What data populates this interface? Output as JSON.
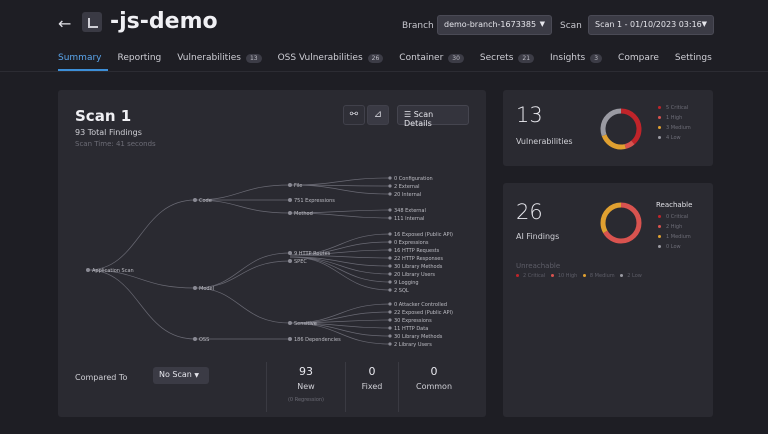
{
  "header": {
    "back": "←",
    "title": "-js-demo",
    "branch_label": "Branch",
    "branch_value": "demo-branch-1673385",
    "scan_label": "Scan",
    "scan_value": "Scan 1 - 01/10/2023 03:16"
  },
  "tabs": [
    {
      "label": "Summary",
      "badge": null,
      "active": true
    },
    {
      "label": "Reporting",
      "badge": null
    },
    {
      "label": "Vulnerabilities",
      "badge": "13"
    },
    {
      "label": "OSS Vulnerabilities",
      "badge": "26"
    },
    {
      "label": "Container",
      "badge": "30"
    },
    {
      "label": "Secrets",
      "badge": "21"
    },
    {
      "label": "Insights",
      "badge": "3"
    },
    {
      "label": "Compare",
      "badge": null
    },
    {
      "label": "Settings",
      "badge": null
    }
  ],
  "summary": {
    "scan_title": "Scan 1",
    "total_findings": "93 Total Findings",
    "scan_time": "Scan Time: 41 seconds",
    "details_button": "Scan Details",
    "tree": {
      "root": "Application Scan",
      "level1": [
        "Code",
        "Model",
        "OSS"
      ],
      "level2": [
        "File",
        "751 Expressions",
        "Method",
        "9 HTTP Routes",
        "SPEC",
        "Sensitive",
        "186 Dependencies"
      ],
      "leaves": [
        "0 Configuration",
        "2 External",
        "20 Internal",
        "348 External",
        "111 Internal",
        "16 Exposed (Public API)",
        "0 Expressions",
        "16 HTTP Requests",
        "22 HTTP Responses",
        "30 Library Methods",
        "20 Library Users",
        "9 Logging",
        "2 SQL",
        "0 Attacker Controlled",
        "22 Exposed (Public API)",
        "30 Expressions",
        "11 HTTP Data",
        "30 Library Methods",
        "2 Library Users"
      ]
    },
    "compared_label": "Compared To",
    "compared_value": "No Scan",
    "stats": [
      {
        "value": "93",
        "label": "New",
        "sub": "(0 Regression)"
      },
      {
        "value": "0",
        "label": "Fixed",
        "sub": ""
      },
      {
        "value": "0",
        "label": "Common",
        "sub": ""
      }
    ]
  },
  "vuln_card": {
    "count": "13",
    "label": "Vulnerabilities",
    "legend": [
      {
        "text": "5 Critical",
        "color": "#c0242a"
      },
      {
        "text": "1 High",
        "color": "#d9534f"
      },
      {
        "text": "3 Medium",
        "color": "#e0a030"
      },
      {
        "text": "4 Low",
        "color": "#9a9aa2"
      }
    ]
  },
  "ai_card": {
    "count": "26",
    "label": "AI Findings",
    "reachable_label": "Reachable",
    "legend": [
      {
        "text": "0 Critical",
        "color": "#c0242a"
      },
      {
        "text": "2 High",
        "color": "#d9534f"
      },
      {
        "text": "1 Medium",
        "color": "#e0a030"
      },
      {
        "text": "0 Low",
        "color": "#9a9aa2"
      }
    ],
    "unreachable_label": "Unreachable",
    "unreachable": [
      {
        "text": "2 Critical",
        "color": "#c0242a"
      },
      {
        "text": "10 High",
        "color": "#d9534f"
      },
      {
        "text": "8 Medium",
        "color": "#e0a030"
      },
      {
        "text": "2 Low",
        "color": "#9a9aa2"
      }
    ]
  }
}
